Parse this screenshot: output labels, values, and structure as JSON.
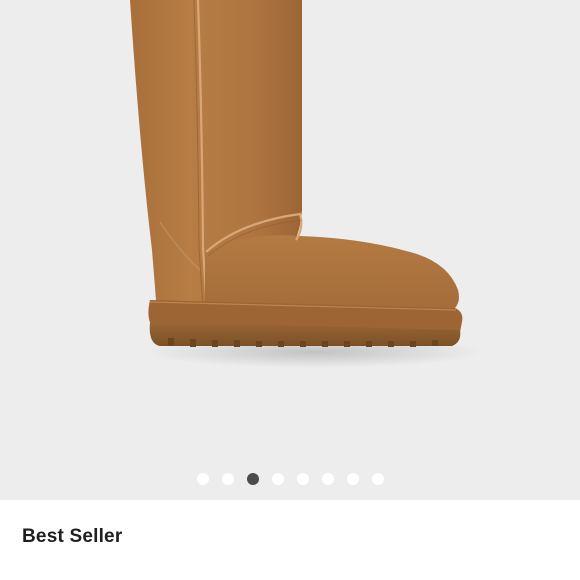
{
  "gallery": {
    "image_subject": "boot-photo",
    "colors": {
      "background": "#ededed",
      "suede": "#b0763f",
      "sole": "#8a5a2b",
      "active_dot": "#4b4b4b",
      "inactive_dot": "#ffffff"
    },
    "pagination": {
      "total": 8,
      "active_index": 2
    }
  },
  "caption": {
    "label": "Best Seller"
  }
}
